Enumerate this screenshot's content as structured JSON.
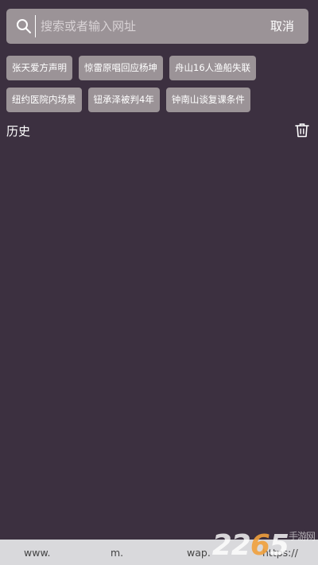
{
  "search": {
    "placeholder": "搜索或者输入网址",
    "cancel_label": "取消"
  },
  "chips": {
    "row1": [
      "张天爱方声明",
      "惊雷原唱回应杨坤",
      "舟山16人渔船失联"
    ],
    "row2": [
      "纽约医院内场景",
      "钮承泽被判4年",
      "钟南山谈复课条件"
    ]
  },
  "history": {
    "title": "历史"
  },
  "bottom_bar": {
    "items": [
      "www.",
      "m.",
      "wap.",
      "https://"
    ]
  },
  "watermark": {
    "main_a": "22",
    "main_b": "6",
    "main_c": "5",
    "site": "手游网"
  },
  "colors": {
    "background": "#3c3040",
    "chip": "#9b9397",
    "bottom_bar": "#d9d9dc"
  }
}
